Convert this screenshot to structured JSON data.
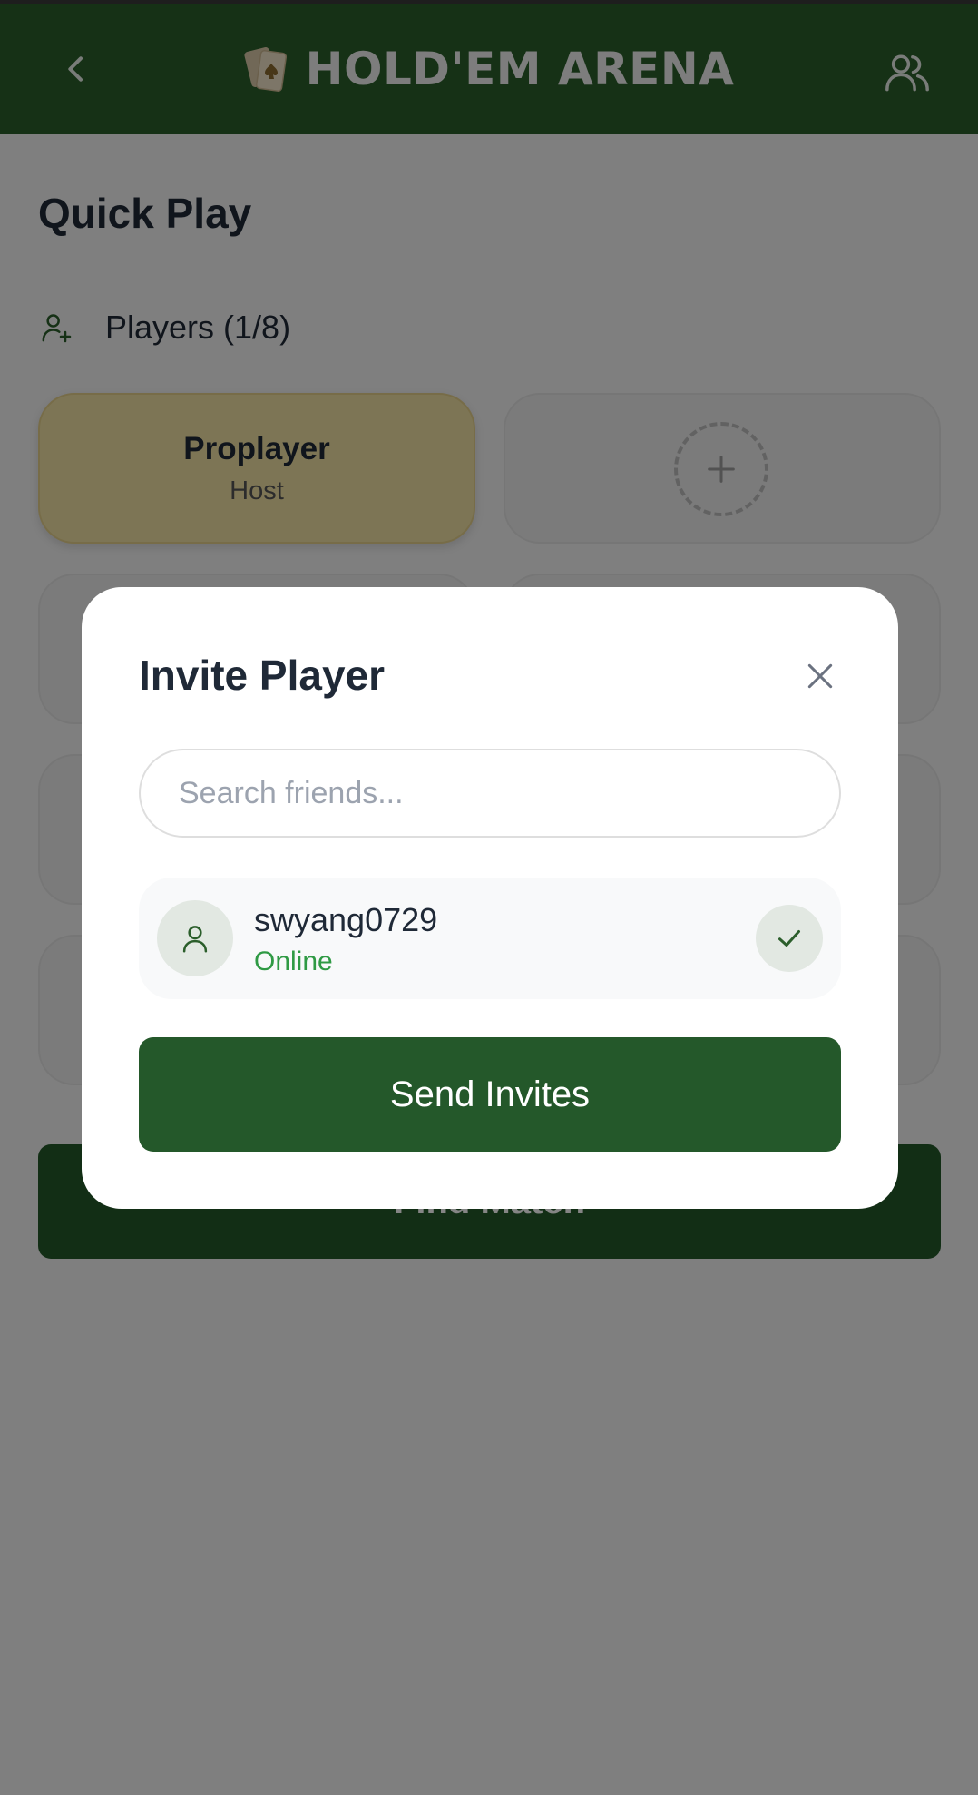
{
  "header": {
    "title": "HOLD'EM ARENA",
    "back_icon": "chevron-left-icon",
    "logo_icon": "playing-cards-icon",
    "friends_icon": "users-icon"
  },
  "page": {
    "title": "Quick Play",
    "players_label": "Players (1/8)",
    "players_icon": "user-plus-icon"
  },
  "slots": {
    "host": {
      "name": "Proplayer",
      "role": "Host"
    },
    "add_icon": "plus-icon"
  },
  "find_match": {
    "label": "Find Match"
  },
  "modal": {
    "title": "Invite Player",
    "close_icon": "close-icon",
    "search_placeholder": "Search friends...",
    "friends": [
      {
        "name": "swyang0729",
        "status": "Online",
        "selected": true
      }
    ],
    "send_label": "Send Invites"
  },
  "colors": {
    "header_bg": "#2b5e2b",
    "primary_button": "#24582a",
    "host_slot": "#efe0a4",
    "online": "#2f9a44"
  }
}
